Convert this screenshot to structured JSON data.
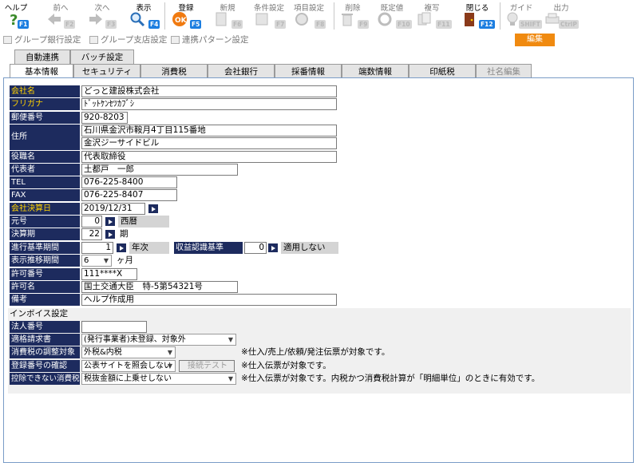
{
  "toolbar": {
    "items": [
      {
        "label": "ヘルプ",
        "fkey": "F1",
        "icon": "help-icon"
      },
      {
        "label": "前へ",
        "fkey": "F2",
        "icon": "prev-arrow-icon"
      },
      {
        "label": "次へ",
        "fkey": "F3",
        "icon": "next-arrow-icon"
      },
      {
        "label": "表示",
        "fkey": "F4",
        "icon": "magnifier-icon"
      },
      {
        "label": "登録",
        "fkey": "F5",
        "icon": "ok-icon"
      },
      {
        "label": "新規",
        "fkey": "F6",
        "icon": "new-document-icon"
      },
      {
        "label": "条件設定",
        "fkey": "F7",
        "icon": "filter-icon"
      },
      {
        "label": "項目設定",
        "fkey": "F8",
        "icon": "gear-icon"
      },
      {
        "label": "削除",
        "fkey": "F9",
        "icon": "trash-icon"
      },
      {
        "label": "既定値",
        "fkey": "F10",
        "icon": "refresh-icon"
      },
      {
        "label": "複写",
        "fkey": "F11",
        "icon": "copy-icon"
      },
      {
        "label": "閉じる",
        "fkey": "F12",
        "icon": "door-icon"
      },
      {
        "label": "ガイド",
        "fkey": "SHIFT",
        "icon": "lightbulb-icon"
      },
      {
        "label": "出力",
        "fkey": "CtrlP",
        "icon": "printer-icon"
      }
    ]
  },
  "subtabs": {
    "bank_group": "グループ銀行設定",
    "branch_group": "グループ支店設定",
    "link_pattern": "連携パターン設定",
    "edit": "編集"
  },
  "upper_tabs": [
    "自動連携",
    "バッチ設定"
  ],
  "tabs": [
    "基本情報",
    "セキュリティ",
    "消費税",
    "会社銀行",
    "採番情報",
    "端数情報",
    "印紙税",
    "社名編集"
  ],
  "form": {
    "company_name": {
      "label": "会社名",
      "value": "どっと建設株式会社"
    },
    "furigana": {
      "label": "フリガナ",
      "value": "ﾄﾞｯﾄｹﾝｾﾂｶﾌﾞｼ"
    },
    "postal_code": {
      "label": "郵便番号",
      "value": "920-8203"
    },
    "address": {
      "label": "住所",
      "line1": "石川県金沢市鞍月4丁目115番地",
      "line2": "金沢ジーサイドビル"
    },
    "title": {
      "label": "役職名",
      "value": "代表取締役"
    },
    "representative": {
      "label": "代表者",
      "value": "土都戸　一郎"
    },
    "tel": {
      "label": "TEL",
      "value": "076-225-8400"
    },
    "fax": {
      "label": "FAX",
      "value": "076-225-8407"
    },
    "fiscal_date": {
      "label": "会社決算日",
      "value": "2019/12/31"
    },
    "era": {
      "label": "元号",
      "value": "0",
      "name": "西暦"
    },
    "fiscal_period": {
      "label": "決算期",
      "value": "22",
      "unit": "期"
    },
    "progress_base": {
      "label": "進行基準期間",
      "value": "1",
      "unit": "年次"
    },
    "revenue_standard": {
      "label": "収益認識基準",
      "value": "0",
      "name": "適用しない"
    },
    "display_period": {
      "label": "表示推移期間",
      "value": "6",
      "unit": "ヶ月"
    },
    "permit_number": {
      "label": "許可番号",
      "value": "111****X"
    },
    "permit_name": {
      "label": "許可名",
      "value": "国土交通大臣　特-5第54321号"
    },
    "remarks": {
      "label": "備考",
      "value": "ヘルプ作成用"
    }
  },
  "invoice": {
    "title": "インボイス設定",
    "corp_number": {
      "label": "法人番号",
      "value": ""
    },
    "qualified_invoice": {
      "label": "適格請求書",
      "value": "(発行事業者)未登録、対象外"
    },
    "tax_adjust": {
      "label": "消費税の調整対象",
      "value": "外税&内税",
      "note": "※仕入/売上/依頼/発注伝票が対象です。"
    },
    "reg_check": {
      "label": "登録番号の確認",
      "value": "公表サイトを照会しない",
      "test_button": "接続テスト",
      "note": "※仕入伝票が対象です。"
    },
    "non_deductible": {
      "label": "控除できない消費税",
      "value": "税抜金額に上乗せしない",
      "note": "※仕入伝票が対象です。内税かつ消費税計算が「明細単位」のときに有効です。"
    }
  }
}
